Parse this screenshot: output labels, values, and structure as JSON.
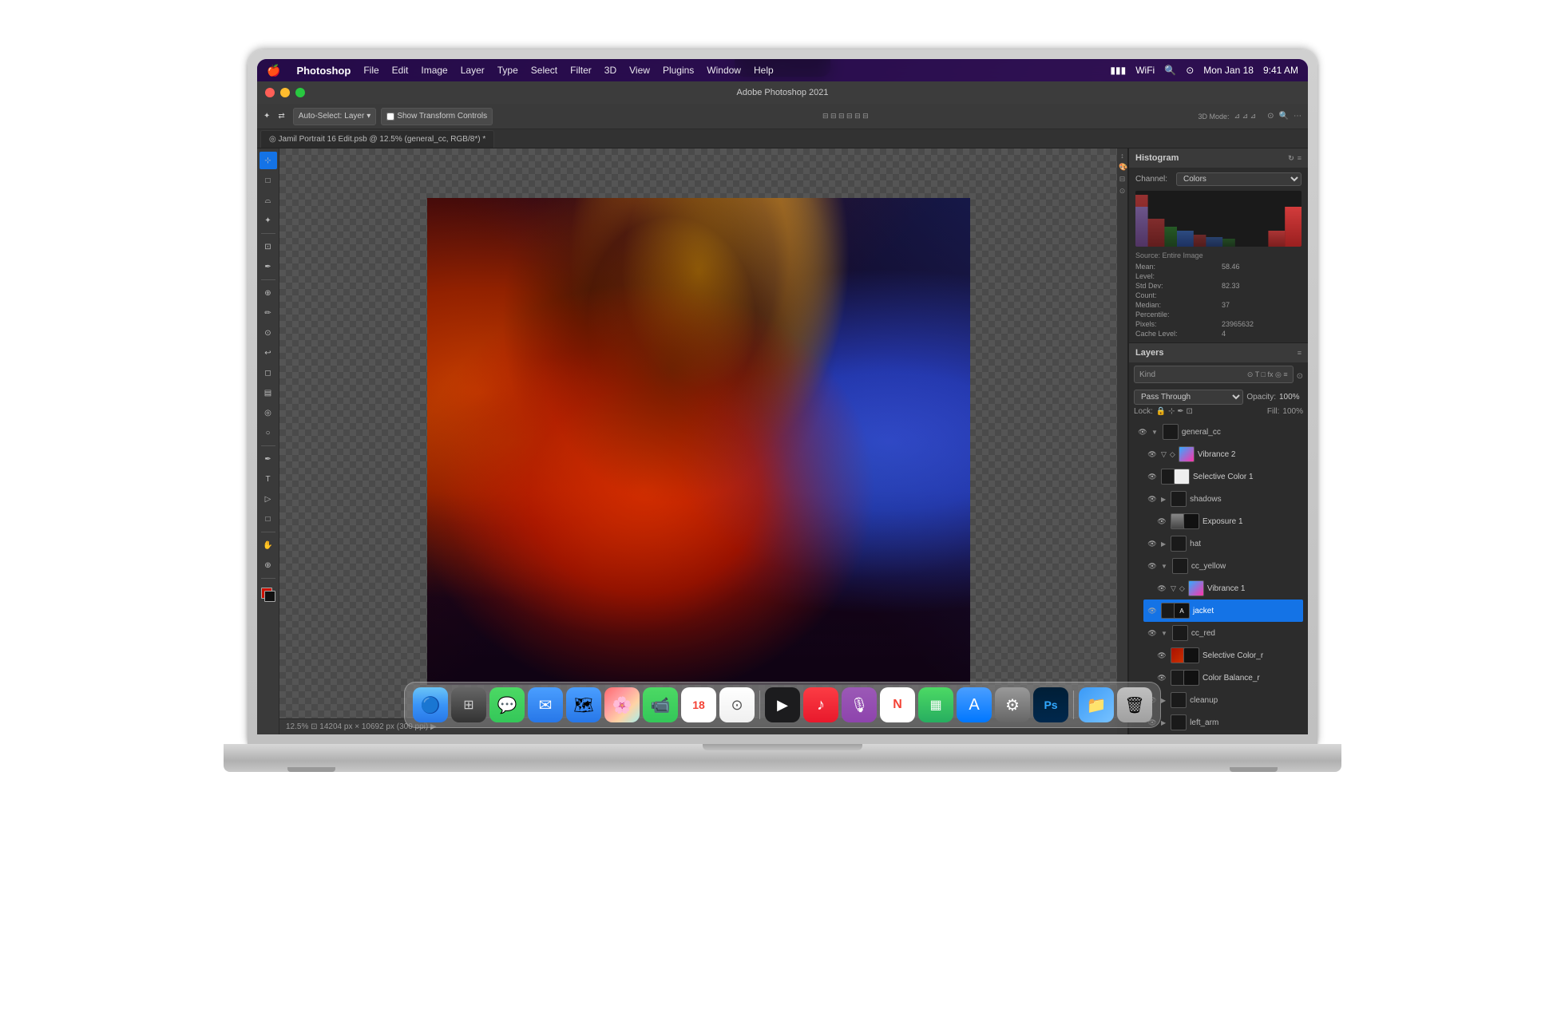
{
  "macbook": {
    "screen_title": "Adobe Photoshop 2021"
  },
  "menubar": {
    "apple": "🍎",
    "app_name": "Photoshop",
    "items": [
      "File",
      "Edit",
      "Image",
      "Layer",
      "Type",
      "Select",
      "Filter",
      "3D",
      "View",
      "Plugins",
      "Window",
      "Help"
    ],
    "right_items": [
      "Mon Jan 18",
      "9:41 AM"
    ]
  },
  "ps_window": {
    "title": "Adobe Photoshop 2021",
    "tab_label": "◎ Jamil Portrait 16 Edit.psb @ 12.5% (general_cc, RGB/8*) *",
    "status_bar": "12.5% ⊡ 14204 px × 10692 px (300 ppi) ▶"
  },
  "toolbar_top": {
    "auto_select": "Auto-Select:",
    "layer_label": "Layer",
    "transform_label": "Show Transform Controls"
  },
  "histogram": {
    "title": "Histogram",
    "channel_label": "Channel:",
    "channel_value": "Colors",
    "source_label": "Source:",
    "source_value": "Entire Image",
    "stats": [
      {
        "label": "Mean:",
        "value": "58.46"
      },
      {
        "label": "Level:",
        "value": ""
      },
      {
        "label": "Std Dev:",
        "value": "82.33"
      },
      {
        "label": "Count:",
        "value": ""
      },
      {
        "label": "Median:",
        "value": "37"
      },
      {
        "label": "Percentile:",
        "value": ""
      },
      {
        "label": "Pixels:",
        "value": "23965632"
      },
      {
        "label": "Cache Level:",
        "value": "4"
      }
    ]
  },
  "layers": {
    "title": "Layers",
    "search_placeholder": "Kind",
    "pass_through": "Pass Through",
    "opacity_label": "Opacity:",
    "opacity_value": "100%",
    "lock_label": "Lock:",
    "fill_label": "Fill:",
    "fill_value": "100%",
    "items": [
      {
        "name": "general_cc",
        "type": "group",
        "indent": 0,
        "visible": true
      },
      {
        "name": "Vibrance 2",
        "type": "adjustment",
        "indent": 1,
        "visible": true
      },
      {
        "name": "Selective Color 1",
        "type": "adjustment",
        "indent": 1,
        "visible": true
      },
      {
        "name": "shadows",
        "type": "group",
        "indent": 1,
        "visible": true
      },
      {
        "name": "Exposure 1",
        "type": "adjustment",
        "indent": 2,
        "visible": true
      },
      {
        "name": "hat",
        "type": "group",
        "indent": 1,
        "visible": true
      },
      {
        "name": "cc_yellow",
        "type": "group",
        "indent": 1,
        "visible": true
      },
      {
        "name": "Vibrance 1",
        "type": "adjustment",
        "indent": 2,
        "visible": true
      },
      {
        "name": "jacket",
        "type": "layer",
        "indent": 1,
        "visible": true,
        "active": true
      },
      {
        "name": "cc_red",
        "type": "group",
        "indent": 1,
        "visible": true
      },
      {
        "name": "Selective Color_r",
        "type": "adjustment",
        "indent": 2,
        "visible": true
      },
      {
        "name": "Color Balance_r",
        "type": "adjustment",
        "indent": 2,
        "visible": true
      },
      {
        "name": "cleanup",
        "type": "group",
        "indent": 1,
        "visible": true
      },
      {
        "name": "left_arm",
        "type": "group",
        "indent": 1,
        "visible": true
      }
    ]
  },
  "dock": {
    "icons": [
      {
        "name": "Finder",
        "class": "dock-finder",
        "symbol": "🔵"
      },
      {
        "name": "Launchpad",
        "class": "dock-launchpad",
        "symbol": "⊞"
      },
      {
        "name": "Messages",
        "class": "dock-messages",
        "symbol": "💬"
      },
      {
        "name": "Mail",
        "class": "dock-mail",
        "symbol": "✉"
      },
      {
        "name": "Maps",
        "class": "dock-maps",
        "symbol": "🗺"
      },
      {
        "name": "Photos",
        "class": "dock-photos",
        "symbol": "🌸"
      },
      {
        "name": "FaceTime",
        "class": "dock-facetime",
        "symbol": "📹"
      },
      {
        "name": "Calendar",
        "class": "dock-calendar",
        "symbol": "18"
      },
      {
        "name": "Contacts",
        "class": "dock-contacts",
        "symbol": "⊙"
      },
      {
        "name": "AppleTV",
        "class": "dock-appletv",
        "symbol": "▶"
      },
      {
        "name": "Music",
        "class": "dock-music",
        "symbol": "♪"
      },
      {
        "name": "Podcasts",
        "class": "dock-podcasts",
        "symbol": "🎙"
      },
      {
        "name": "News",
        "class": "dock-news",
        "symbol": "N"
      },
      {
        "name": "Numbers",
        "class": "dock-numbers",
        "symbol": "▦"
      },
      {
        "name": "AppStore",
        "class": "dock-appstore",
        "symbol": "A"
      },
      {
        "name": "SystemPrefs",
        "class": "dock-systemprefs",
        "symbol": "⚙"
      },
      {
        "name": "Photoshop",
        "class": "dock-ps",
        "symbol": "Ps"
      },
      {
        "name": "Finder2",
        "class": "dock-finder2",
        "symbol": "📁"
      },
      {
        "name": "Trash",
        "class": "dock-trash",
        "symbol": "🗑"
      }
    ]
  }
}
